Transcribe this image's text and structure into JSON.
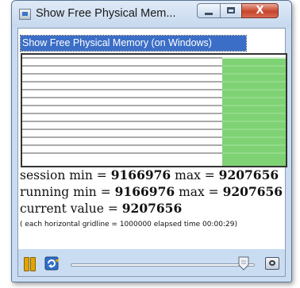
{
  "window": {
    "title": "Show Free Physical Mem...",
    "close_glyph": "X"
  },
  "header": {
    "label": "Show Free Physical Memory (on Windows)"
  },
  "chart_data": {
    "type": "area",
    "title": "",
    "xlabel": "",
    "ylabel": "",
    "gridlines": 13,
    "fill_fraction_of_width": 0.24,
    "color": "#7ed274"
  },
  "stats": {
    "session_prefix": "session min = ",
    "session_min": "9166976",
    "session_mid": " max = ",
    "session_max": "9207656",
    "running_prefix": "running min = ",
    "running_min": "9166976",
    "running_mid": " max = ",
    "running_max": "9207656",
    "current_prefix": "current value = ",
    "current_value": "9207656",
    "note": "( each horizontal gridline = 1000000 elapsed time 00:00:29)"
  },
  "controls": {
    "slider_position": 0.94
  },
  "icons": {
    "app": "app-icon",
    "minimize": "minimize-icon",
    "maximize": "maximize-icon",
    "close": "close-icon",
    "pause": "pause-icon",
    "refresh": "refresh-icon",
    "slider": "slider-thumb-icon",
    "snapshot": "snapshot-icon"
  }
}
